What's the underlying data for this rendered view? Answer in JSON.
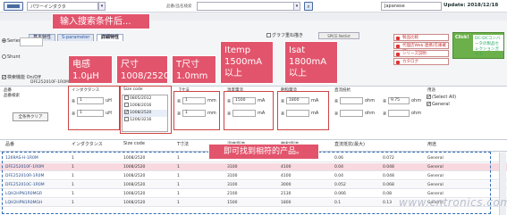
{
  "header": {
    "title_value": "パワーインダクタ",
    "keyword_label": "品番/品名検索",
    "language": "Japanese",
    "update": "Update: 2018/12/18"
  },
  "banner": "输入搜索条件后...",
  "tabs": [
    "基本特性",
    "S-parameter",
    "詳細特性"
  ],
  "options": {
    "graph_overlay": "グラフ重ね描き",
    "spice_button": "SPICE Netlist",
    "series": "Series",
    "shunt": "Shunt",
    "filter_label": "検索機能 On/Off"
  },
  "right_buttons": [
    "製品比較",
    "代理店Web 連携(在庫確認)",
    "シリーズ説明",
    "カタログ"
  ],
  "ad": {
    "tag": "Click!",
    "text": "DC-DCコンバータの製品セレクションガイド"
  },
  "callouts": {
    "inductance": "电感 1.0μH",
    "size": "尺寸 1008/2520",
    "tsize": "T尺寸 1.0mm",
    "itemp": "Itemp 1500mA 以上",
    "isat": "Isat 1800mA 以上",
    "result": "即可找到相符的产品。"
  },
  "filters": {
    "part_label": "品番",
    "part_search_label": "品番検索",
    "part_value": "DFE252010F-1R0M",
    "inductance_head": "インダクタンス",
    "inductance_min": "1",
    "inductance_max": "1",
    "inductance_unit": "uH",
    "size_head": "Size code",
    "sizes": [
      {
        "label": "0805/2012",
        "checked": false
      },
      {
        "label": "1008/2016",
        "checked": false
      },
      {
        "label": "1008/2520",
        "checked": true
      },
      {
        "label": "1206/3216",
        "checked": false
      }
    ],
    "t_head": "T寸法",
    "t_min": "1",
    "t_max": "1",
    "t_unit": "mm",
    "itemp_head": "温度電流",
    "itemp_min": "1500",
    "itemp_unit": "mA",
    "isat_head": "飽和電流",
    "isat_min": "1800",
    "isat_unit": "mA",
    "dcr_head": "直流抵抗",
    "dcr_unit": "ohm",
    "dcr_max": "9.75",
    "use_head": "用途",
    "uses": [
      {
        "label": "(Select All)",
        "checked": true
      },
      {
        "label": "General",
        "checked": true
      }
    ],
    "clear_button": "全条件クリア"
  },
  "results": {
    "columns": [
      "品番",
      "インダクタンス",
      "Size code",
      "T寸法",
      "温度電流",
      "飽和電流",
      "直流抵抗(最大)",
      "用途"
    ],
    "rows": [
      {
        "part": "1269AS-H-1R0M",
        "ind": "1",
        "size": "1008/2520",
        "t": "1",
        "itemp": "2500",
        "isat": "2800",
        "dcr1": "0.06",
        "dcr2": "0.072",
        "use": "General",
        "hl": false
      },
      {
        "part": "DFE252010F-1R0M",
        "ind": "1",
        "size": "1008/2520",
        "t": "1",
        "itemp": "3100",
        "isat": "4100",
        "dcr1": "0.04",
        "dcr2": "0.048",
        "use": "General",
        "hl": true
      },
      {
        "part": "DFE252010R-1R0M",
        "ind": "1",
        "size": "1008/2520",
        "t": "1",
        "itemp": "3100",
        "isat": "4100",
        "dcr1": "0.04",
        "dcr2": "0.048",
        "use": "General",
        "hl": false
      },
      {
        "part": "DFE252010C-1R0M",
        "ind": "1",
        "size": "1008/2520",
        "t": "1",
        "itemp": "3100",
        "isat": "3000",
        "dcr1": "0.052",
        "dcr2": "0.068",
        "use": "General",
        "hl": false
      },
      {
        "part": "LQH2HPN1R0MGR",
        "ind": "1",
        "size": "1008/2520",
        "t": "1",
        "itemp": "2100",
        "isat": "2130",
        "dcr1": "0.066",
        "dcr2": "0.08",
        "use": "General",
        "hl": false
      },
      {
        "part": "LQH2HPN1R0MGH",
        "ind": "1",
        "size": "1008/2520",
        "t": "1",
        "itemp": "1500",
        "isat": "1800",
        "dcr1": "0.1",
        "dcr2": "0.13",
        "use": "General",
        "hl": false
      }
    ]
  },
  "watermark": "www.cntronics.com"
}
